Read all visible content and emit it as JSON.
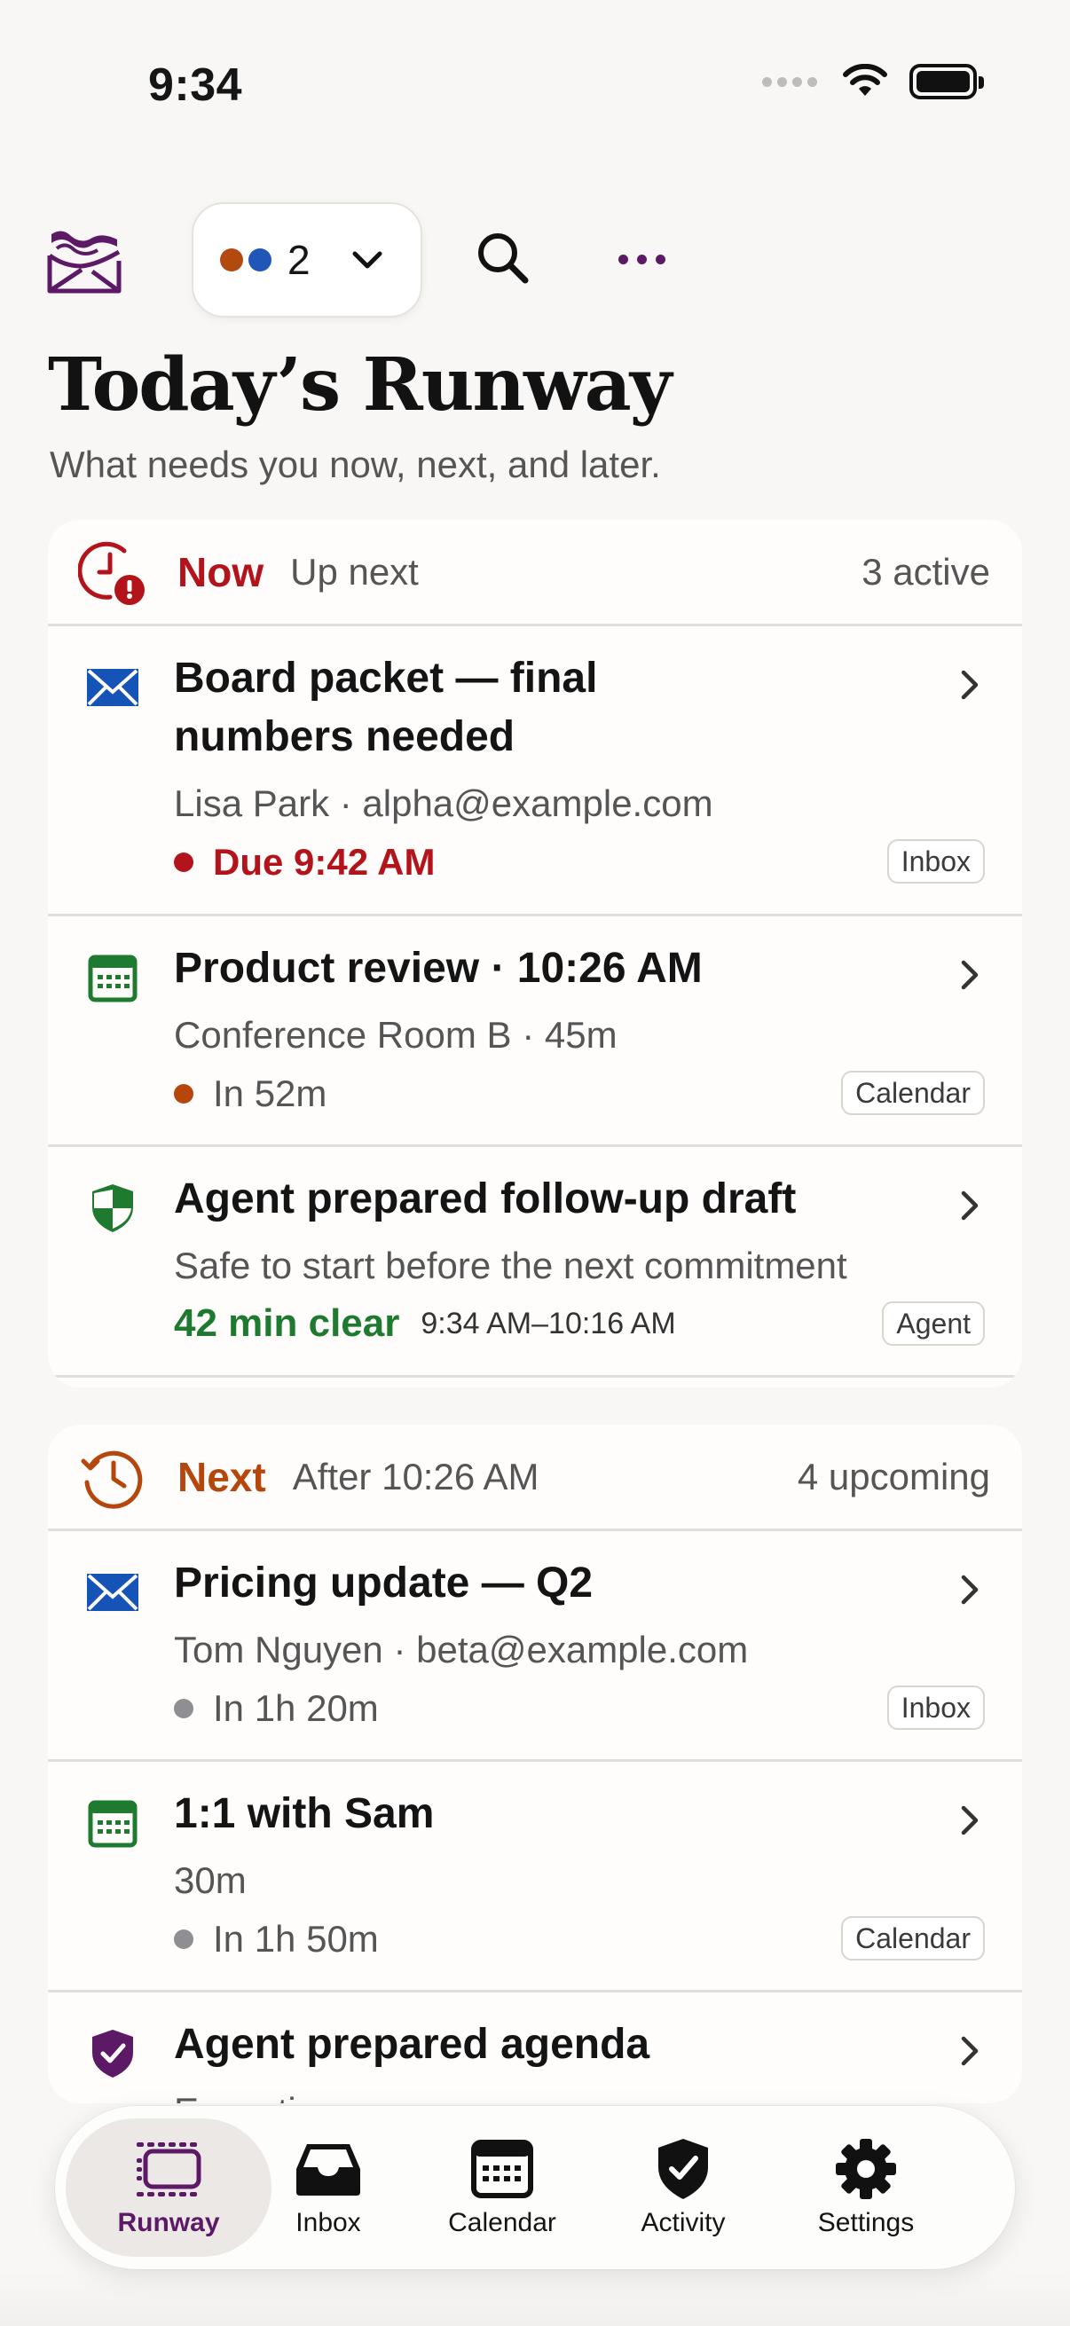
{
  "status_bar": {
    "time": "9:34"
  },
  "toolbar": {
    "account_count": "2",
    "account_dot_colors": [
      "#b24a10",
      "#1f56b8"
    ],
    "icons": [
      "app-logo",
      "chevron-down-icon",
      "search-icon",
      "more-icon"
    ]
  },
  "header": {
    "title": "Today’s Runway",
    "subtitle": "What needs you now, next, and later."
  },
  "now": {
    "title": "Now",
    "subtitle": "Up next",
    "count": "3 active",
    "accent": "#b3141b",
    "items": [
      {
        "icon": "mail-icon",
        "title_line1": "Board packet — final",
        "title_line2": "numbers needed",
        "subtitle": "Lisa Park · alpha@example.com",
        "meta": "Due 9:42 AM",
        "meta_color": "#b3141b",
        "tag": "Inbox"
      },
      {
        "icon": "calendar-icon",
        "title": "Product review · 10:26 AM",
        "subtitle": "Conference Room B · 45m",
        "meta": "In 52m",
        "meta_color": "#b5470d",
        "tag": "Calendar"
      },
      {
        "icon": "shield-icon",
        "title": "Agent prepared follow-up draft",
        "subtitle": "Safe to start before the next commitment",
        "meta": "42 min clear",
        "meta_time": "9:34 AM–10:16 AM",
        "meta_color": "#1e7a2e",
        "tag": "Agent"
      }
    ]
  },
  "next": {
    "title": "Next",
    "subtitle": "After 10:26 AM",
    "count": "4 upcoming",
    "accent": "#b5470d",
    "items": [
      {
        "icon": "mail-icon",
        "title": "Pricing update — Q2",
        "subtitle": "Tom Nguyen · beta@example.com",
        "meta": "In 1h 20m",
        "tag": "Inbox"
      },
      {
        "icon": "calendar-icon",
        "title": "1:1 with Sam",
        "subtitle": "30m",
        "meta": "In 1h 50m",
        "tag": "Calendar"
      },
      {
        "icon": "shield-icon",
        "title": "Agent prepared agenda",
        "subtitle": "Executive sync"
      }
    ]
  },
  "tabs": [
    {
      "label": "Runway",
      "icon": "runway-icon",
      "active": true
    },
    {
      "label": "Inbox",
      "icon": "inbox-icon",
      "active": false
    },
    {
      "label": "Calendar",
      "icon": "calendar-icon",
      "active": false
    },
    {
      "label": "Activity",
      "icon": "activity-shield-icon",
      "active": false
    },
    {
      "label": "Settings",
      "icon": "gear-icon",
      "active": false
    }
  ],
  "colors": {
    "brand": "#5c1a66",
    "mail_blue": "#1553b6",
    "calendar_green": "#1e7a2e",
    "now_red": "#b3141b",
    "next_orange": "#b5470d",
    "muted_dot": "#8e8e93"
  }
}
